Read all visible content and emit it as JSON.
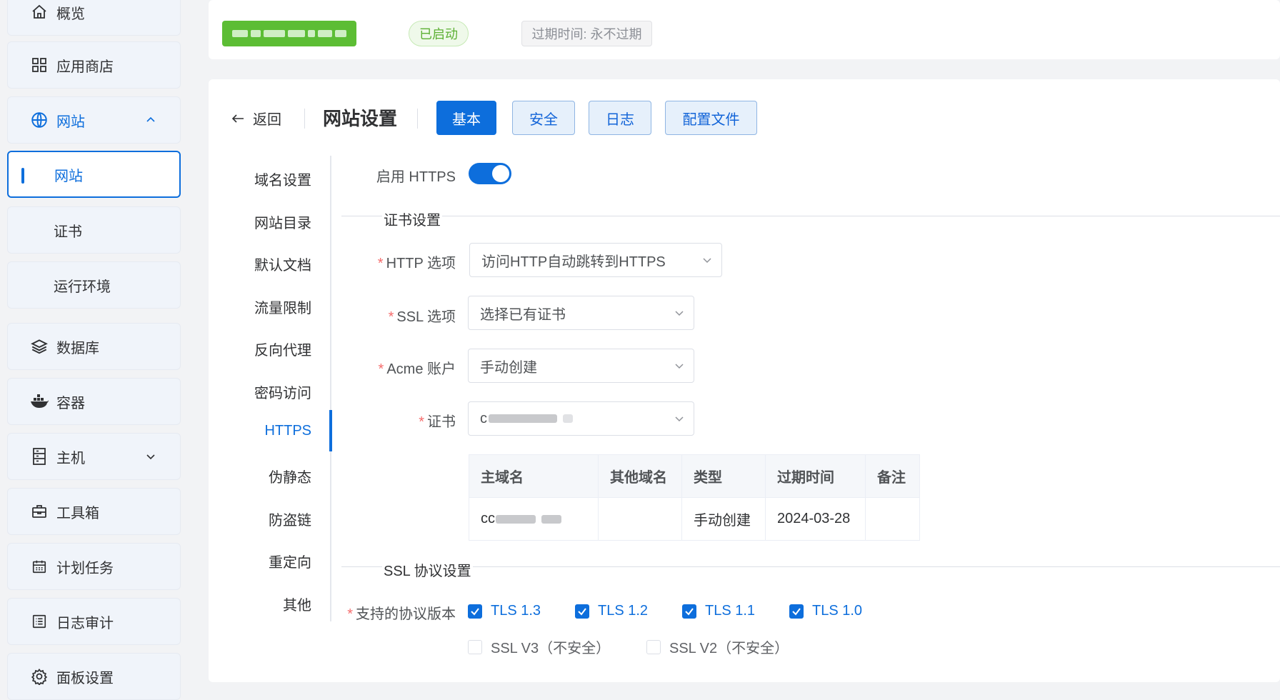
{
  "sidebar": {
    "items": [
      {
        "label": "概览",
        "icon": "home-icon"
      },
      {
        "label": "应用商店",
        "icon": "grid-icon"
      },
      {
        "label": "网站",
        "icon": "globe-icon"
      },
      {
        "label": "数据库",
        "icon": "layers-icon"
      },
      {
        "label": "容器",
        "icon": "docker-icon"
      },
      {
        "label": "主机",
        "icon": "server-icon"
      },
      {
        "label": "工具箱",
        "icon": "toolbox-icon"
      },
      {
        "label": "计划任务",
        "icon": "calendar-icon"
      },
      {
        "label": "日志审计",
        "icon": "log-icon"
      },
      {
        "label": "面板设置",
        "icon": "gear-icon"
      }
    ],
    "website_sub": [
      "网站",
      "证书",
      "运行环境"
    ]
  },
  "status": {
    "running": "已启动",
    "expire": "过期时间: 永不过期"
  },
  "header": {
    "back": "返回",
    "title": "网站设置",
    "tabs": [
      "基本",
      "安全",
      "日志",
      "配置文件"
    ]
  },
  "nav": [
    "域名设置",
    "网站目录",
    "默认文档",
    "流量限制",
    "反向代理",
    "密码访问",
    "HTTPS",
    "伪静态",
    "防盗链",
    "重定向",
    "其他"
  ],
  "form": {
    "enable_https_label": "启用 HTTPS",
    "enable_https": true,
    "cert_section": "证书设置",
    "http_option_label": "HTTP 选项",
    "http_option_value": "访问HTTP自动跳转到HTTPS",
    "ssl_option_label": "SSL 选项",
    "ssl_option_value": "选择已有证书",
    "acme_label": "Acme 账户",
    "acme_value": "手动创建",
    "cert_label": "证书",
    "cert_value_prefix": "c",
    "ssl_proto_section": "SSL 协议设置",
    "protocols_label": "支持的协议版本",
    "required_mark": "*"
  },
  "cert_table": {
    "headers": [
      "主域名",
      "其他域名",
      "类型",
      "过期时间",
      "备注"
    ],
    "row": {
      "domain_prefix": "cc",
      "other": "",
      "type": "手动创建",
      "expire": "2024-03-28",
      "note": ""
    }
  },
  "protocols": [
    {
      "label": "TLS 1.3",
      "checked": true
    },
    {
      "label": "TLS 1.2",
      "checked": true
    },
    {
      "label": "TLS 1.1",
      "checked": true
    },
    {
      "label": "TLS 1.0",
      "checked": true
    },
    {
      "label": "SSL V3（不安全）",
      "checked": false
    },
    {
      "label": "SSL V2（不安全）",
      "checked": false
    }
  ],
  "colors": {
    "accent": "#0d6edc",
    "success": "#5cbd34",
    "required": "#f56c6c"
  }
}
